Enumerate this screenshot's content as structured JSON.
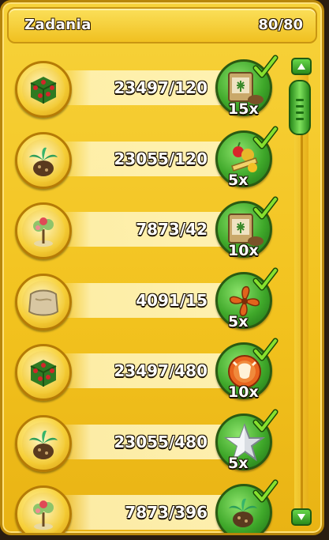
{
  "header": {
    "title": "Zadania",
    "count": "80/80"
  },
  "tasks": [
    {
      "progress": "23497/120",
      "item_icon": "rose-hedge-cube-icon",
      "reward_icon": "fertilizer-bag-icon",
      "reward_multiplier": "15x",
      "completed": true
    },
    {
      "progress": "23055/120",
      "item_icon": "palm-tree-seedling-icon",
      "reward_icon": "fruit-bunch-icon",
      "reward_multiplier": "5x",
      "completed": true
    },
    {
      "progress": "7873/42",
      "item_icon": "flower-tree-in-pot-icon",
      "reward_icon": "fertilizer-bag-icon",
      "reward_multiplier": "10x",
      "completed": true
    },
    {
      "progress": "4091/15",
      "item_icon": "cloth-sack-icon",
      "reward_icon": "fan-propeller-icon",
      "reward_multiplier": "5x",
      "completed": true
    },
    {
      "progress": "23497/480",
      "item_icon": "rose-hedge-cube-icon",
      "reward_icon": "cow-coin-icon",
      "reward_multiplier": "10x",
      "completed": true
    },
    {
      "progress": "23055/480",
      "item_icon": "palm-tree-seedling-icon",
      "reward_icon": "silver-star-icon",
      "reward_multiplier": "5x",
      "completed": true
    },
    {
      "progress": "7873/396",
      "item_icon": "flower-tree-in-pot-icon",
      "reward_icon": "palm-tree-seedling-icon",
      "reward_multiplier": "",
      "completed": true
    }
  ],
  "colors": {
    "panel": "#f2c21e",
    "reward_ring": "#3fa82a",
    "check": "#7fdc2a",
    "text_outline": "#1a1000"
  }
}
